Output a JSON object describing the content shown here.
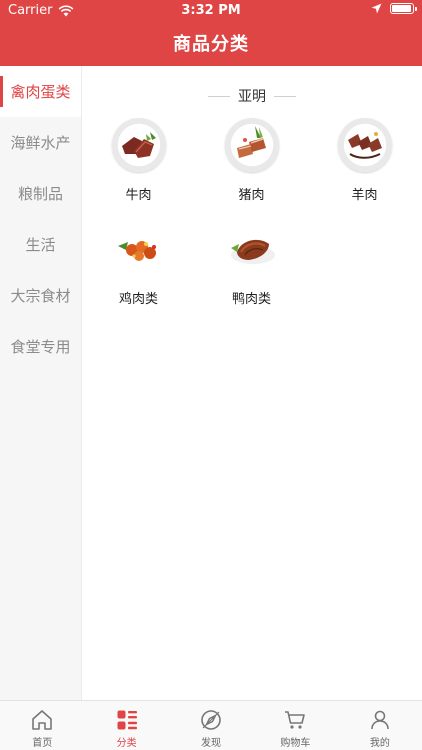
{
  "status_bar": {
    "carrier": "Carrier",
    "time": "3:32 PM"
  },
  "header": {
    "title": "商品分类"
  },
  "sidebar": {
    "items": [
      {
        "label": "禽肉蛋类",
        "active": true
      },
      {
        "label": "海鲜水产",
        "active": false
      },
      {
        "label": "粮制品",
        "active": false
      },
      {
        "label": "生活",
        "active": false
      },
      {
        "label": "大宗食材",
        "active": false
      },
      {
        "label": "食堂专用",
        "active": false
      }
    ]
  },
  "main": {
    "section_title": "亚明",
    "products": [
      {
        "label": "牛肉",
        "image": "beef-image"
      },
      {
        "label": "猪肉",
        "image": "pork-image"
      },
      {
        "label": "羊肉",
        "image": "lamb-image"
      },
      {
        "label": "鸡肉类",
        "image": "chicken-image"
      },
      {
        "label": "鸭肉类",
        "image": "duck-image"
      }
    ]
  },
  "tabbar": {
    "tabs": [
      {
        "label": "首页",
        "icon": "home-icon",
        "active": false
      },
      {
        "label": "分类",
        "icon": "category-icon",
        "active": true
      },
      {
        "label": "发现",
        "icon": "discover-icon",
        "active": false
      },
      {
        "label": "购物车",
        "icon": "cart-icon",
        "active": false
      },
      {
        "label": "我的",
        "icon": "profile-icon",
        "active": false
      }
    ]
  },
  "colors": {
    "accent": "#e04545",
    "inactive_text": "#8b8b8b",
    "sidebar_bg": "#f6f6f6"
  }
}
